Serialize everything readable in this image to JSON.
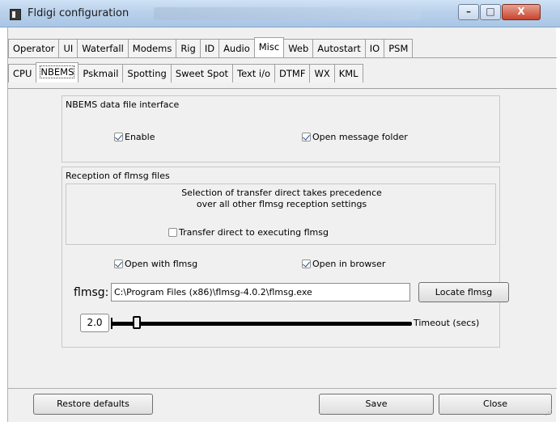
{
  "window": {
    "title": "Fldigi configuration"
  },
  "caption": {
    "min": "–",
    "max": "□",
    "close": "X"
  },
  "tabs_main": [
    "Operator",
    "UI",
    "Waterfall",
    "Modems",
    "Rig",
    "ID",
    "Audio",
    "Misc",
    "Web",
    "Autostart",
    "IO",
    "PSM"
  ],
  "tabs_main_active": "Misc",
  "tabs_sub": [
    "CPU",
    "NBEMS",
    "Pskmail",
    "Spotting",
    "Sweet Spot",
    "Text i/o",
    "DTMF",
    "WX",
    "KML"
  ],
  "tabs_sub_active": "NBEMS",
  "nbems": {
    "title": "NBEMS data file interface",
    "enable_label": "Enable",
    "enable_checked": true,
    "open_folder_label": "Open message folder",
    "open_folder_checked": true
  },
  "reception": {
    "title": "Reception of flmsg files",
    "note_line1": "Selection of transfer direct takes precedence",
    "note_line2": "over all other flmsg reception settings",
    "transfer_direct_label": "Transfer direct to executing flmsg",
    "transfer_direct_checked": false,
    "open_with_label": "Open with flmsg",
    "open_with_checked": true,
    "open_browser_label": "Open in browser",
    "open_browser_checked": true,
    "flmsg_label": "flmsg:",
    "flmsg_path": "C:\\Program Files (x86)\\flmsg-4.0.2\\flmsg.exe",
    "locate_button": "Locate flmsg",
    "timeout_value": "2.0",
    "timeout_label": "Timeout (secs)",
    "timeout_slider_fraction": 0.05
  },
  "footer": {
    "restore_defaults": "Restore defaults",
    "save": "Save",
    "close": "Close"
  }
}
